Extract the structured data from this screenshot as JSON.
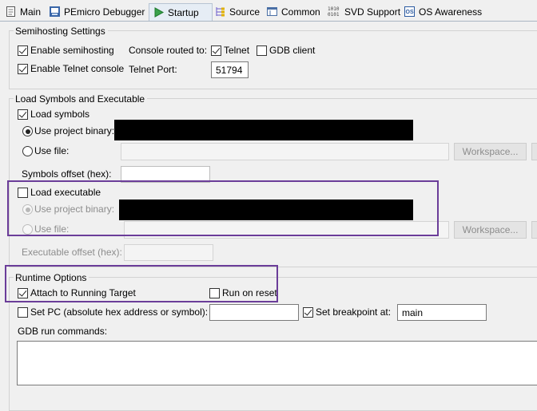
{
  "tabs": [
    {
      "label": "Main",
      "icon": "document-icon"
    },
    {
      "label": "PEmicro Debugger",
      "icon": "debugger-icon"
    },
    {
      "label": "Startup",
      "icon": "startup-play-icon"
    },
    {
      "label": "Source",
      "icon": "source-lookup-icon"
    },
    {
      "label": "Common",
      "icon": "common-tab-icon"
    },
    {
      "label": "SVD Support",
      "icon": "binary-1010-icon"
    },
    {
      "label": "OS Awareness",
      "icon": "os-awareness-icon"
    }
  ],
  "active_tab": "Startup",
  "semihosting": {
    "title": "Semihosting Settings",
    "enable_semihosting_label": "Enable semihosting",
    "enable_semihosting": true,
    "enable_telnet_console_label": "Enable Telnet console",
    "enable_telnet_console": true,
    "console_routed_to_label": "Console routed to:",
    "telnet_label": "Telnet",
    "telnet": true,
    "gdb_client_label": "GDB client",
    "gdb_client": false,
    "telnet_port_label": "Telnet Port:",
    "telnet_port_value": "51794"
  },
  "load_symbols_exec": {
    "title": "Load Symbols and Executable",
    "load_symbols_label": "Load symbols",
    "load_symbols": true,
    "symbols_use_project_binary_label": "Use project binary:",
    "symbols_use_project_binary": true,
    "symbols_use_file_label": "Use file:",
    "symbols_file_value": "",
    "symbols_workspace_label": "Workspace...",
    "symbols_offset_label": "Symbols offset (hex):",
    "symbols_offset_value": "",
    "load_executable_label": "Load executable",
    "load_executable": false,
    "exec_use_project_binary_label": "Use project binary:",
    "exec_use_file_label": "Use file:",
    "exec_file_value": "",
    "exec_workspace_label": "Workspace...",
    "exec_offset_label": "Executable offset (hex):",
    "exec_offset_value": ""
  },
  "runtime": {
    "title": "Runtime Options",
    "attach_label": "Attach to Running Target",
    "attach": true,
    "run_on_reset_label": "Run on reset",
    "run_on_reset": false,
    "set_pc_label": "Set PC (absolute hex address or symbol):",
    "set_pc": false,
    "set_pc_value": "",
    "set_breakpoint_label": "Set breakpoint at:",
    "set_breakpoint": true,
    "breakpoint_value": "main",
    "gdb_run_commands_label": "GDB run commands:",
    "gdb_run_commands_value": ""
  },
  "colors": {
    "highlight": "#6b3d99",
    "redaction": "#000000"
  }
}
